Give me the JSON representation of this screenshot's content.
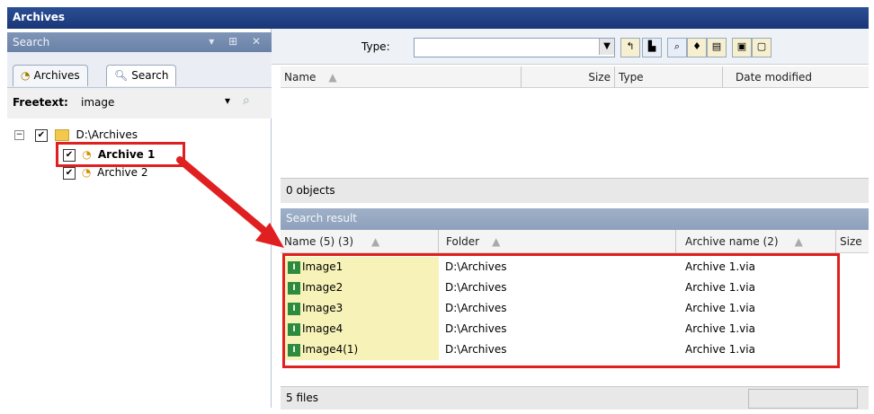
{
  "window": {
    "title": "Archives"
  },
  "search_panel": {
    "header": "Search",
    "header_controls": "▾ ⊞ ✕",
    "tabs": [
      {
        "label": "Archives"
      },
      {
        "label": "Search"
      }
    ],
    "freetext_label": "Freetext:",
    "freetext_value": "image",
    "tree": {
      "root": "D:\\Archives",
      "children": [
        {
          "label": "Archive 1"
        },
        {
          "label": "Archive 2"
        }
      ]
    }
  },
  "toolbar": {
    "type_label": "Type:"
  },
  "file_list": {
    "columns": [
      "Name",
      "Size",
      "Type",
      "Date modified"
    ],
    "status": "0 objects"
  },
  "search_result": {
    "header": "Search result",
    "columns": [
      "Name (5) (3)",
      "Folder",
      "Archive name (2)",
      "Size"
    ],
    "rows": [
      {
        "name": "Image1",
        "folder": "D:\\Archives",
        "archive": "Archive 1.via"
      },
      {
        "name": "Image2",
        "folder": "D:\\Archives",
        "archive": "Archive 1.via"
      },
      {
        "name": "Image3",
        "folder": "D:\\Archives",
        "archive": "Archive 1.via"
      },
      {
        "name": "Image4",
        "folder": "D:\\Archives",
        "archive": "Archive 1.via"
      },
      {
        "name": "Image4(1)",
        "folder": "D:\\Archives",
        "archive": "Archive 1.via"
      }
    ],
    "status": "5 files"
  },
  "colors": {
    "highlight": "#e02020",
    "name_cell_bg": "#f7f3b8"
  }
}
